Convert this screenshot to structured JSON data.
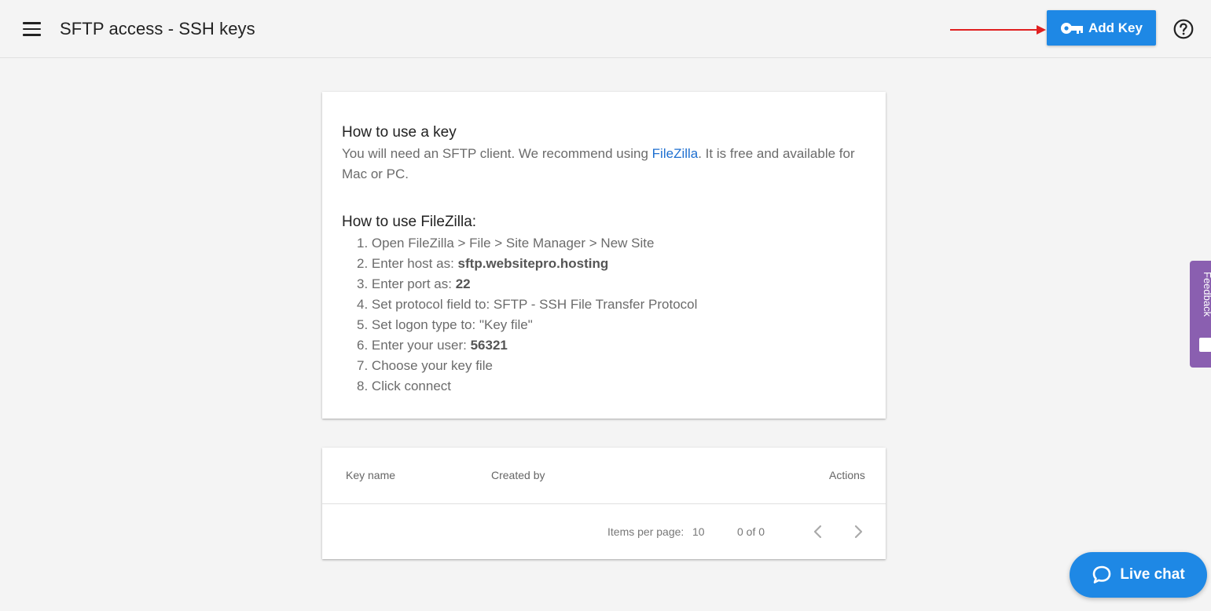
{
  "header": {
    "title": "SFTP access - SSH keys",
    "add_key_label": "Add Key",
    "accent_color": "#1e88e5",
    "annotation_arrow_color": "#e02020"
  },
  "info": {
    "key_title": "How to use a key",
    "key_text_before": "You will need an SFTP client. We recommend using ",
    "key_link": "FileZilla",
    "key_text_after": ". It is free and available for Mac or PC.",
    "filezilla_title": "How to use FileZilla:",
    "steps": [
      {
        "num": "1.",
        "text": "Open FileZilla > File > Site Manager > New Site",
        "bold": ""
      },
      {
        "num": "2.",
        "text": "Enter host as: ",
        "bold": "sftp.websitepro.hosting"
      },
      {
        "num": "3.",
        "text": "Enter port as: ",
        "bold": "22"
      },
      {
        "num": "4.",
        "text": "Set protocol field to: SFTP - SSH File Transfer Protocol",
        "bold": ""
      },
      {
        "num": "5.",
        "text": "Set logon type to: \"Key file\"",
        "bold": ""
      },
      {
        "num": "6.",
        "text": "Enter your user: ",
        "bold": "56321"
      },
      {
        "num": "7.",
        "text": "Choose your key file",
        "bold": ""
      },
      {
        "num": "8.",
        "text": "Click connect",
        "bold": ""
      }
    ]
  },
  "table": {
    "columns": [
      "Key name",
      "Created by",
      "Actions"
    ],
    "rows": [],
    "items_per_page_label": "Items per page:",
    "items_per_page_value": "10",
    "range_label": "0 of 0"
  },
  "feedback": {
    "label": "Feedback",
    "color": "#8a5fb0"
  },
  "live_chat": {
    "label": "Live chat"
  },
  "icons": {
    "menu": "menu-icon",
    "key": "key-icon",
    "help": "help-icon",
    "prev": "chevron-left-icon",
    "next": "chevron-right-icon",
    "chat": "chat-bubble-icon",
    "feedback": "feedback-icon"
  }
}
